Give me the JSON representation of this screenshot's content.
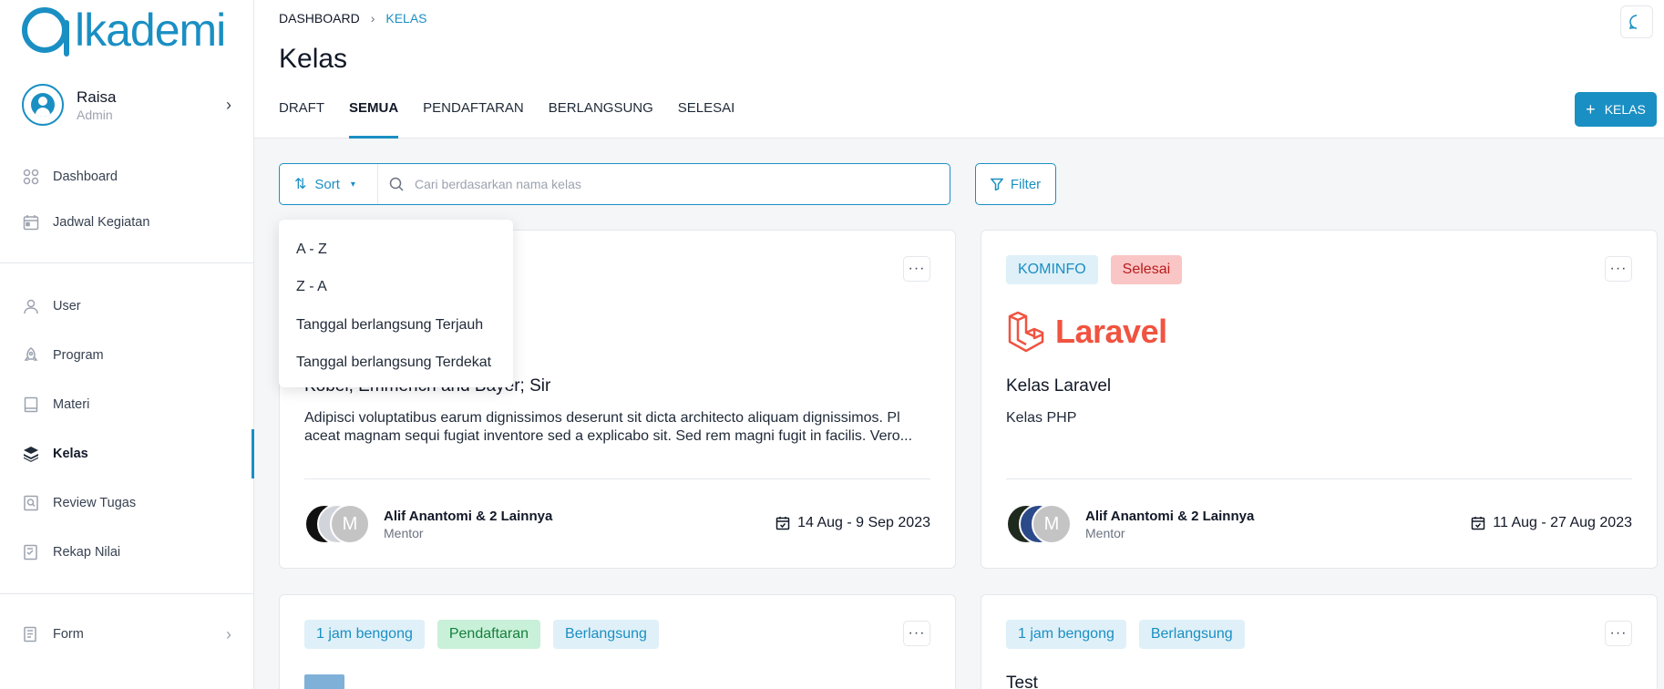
{
  "brand": {
    "logo_text": "lkademi",
    "color": "#1a8fc3"
  },
  "profile": {
    "name": "Raisa",
    "role": "Admin"
  },
  "sidebar": {
    "items": [
      {
        "label": "Dashboard",
        "icon": "grid-icon"
      },
      {
        "label": "Jadwal Kegiatan",
        "icon": "calendar-icon"
      },
      {
        "label": "User",
        "icon": "user-icon"
      },
      {
        "label": "Program",
        "icon": "rocket-icon"
      },
      {
        "label": "Materi",
        "icon": "book-icon"
      },
      {
        "label": "Kelas",
        "icon": "layers-icon",
        "active": true
      },
      {
        "label": "Review Tugas",
        "icon": "review-icon"
      },
      {
        "label": "Rekap Nilai",
        "icon": "checklist-icon"
      },
      {
        "label": "Form",
        "icon": "form-icon"
      }
    ]
  },
  "breadcrumb": {
    "root": "DASHBOARD",
    "current": "KELAS"
  },
  "page": {
    "title": "Kelas"
  },
  "tabs": [
    "DRAFT",
    "SEMUA",
    "PENDAFTARAN",
    "BERLANGSUNG",
    "SELESAI"
  ],
  "active_tab": "SEMUA",
  "toolbar": {
    "add_label": "KELAS",
    "sort_label": "Sort",
    "filter_label": "Filter"
  },
  "search": {
    "placeholder": "Cari berdasarkan nama kelas",
    "value": ""
  },
  "sort_menu": {
    "options": [
      "A - Z",
      "Z - A",
      "Tanggal berlangsung Terjauh",
      "Tanggal berlangsung Terdekat"
    ]
  },
  "cards": [
    {
      "title": "Kobel, Emmerich and Bayer; Sir",
      "description": "Adipisci voluptatibus earum dignissimos deserunt sit dicta architecto aliquam dignissimos. Pl aceat magnam sequi fugiat inventore sed a explicabo sit. Sed rem magni fugit in facilis. Vero...",
      "mentor_name": "Alif Anantomi & 2 Lainnya",
      "mentor_role": "Mentor",
      "avatar_letter": "M",
      "date": "14 Aug - 9 Sep 2023"
    },
    {
      "badges": [
        "KOMINFO",
        "Selesai"
      ],
      "logo_text": "Laravel",
      "title": "Kelas Laravel",
      "subtitle": "Kelas PHP",
      "mentor_name": "Alif Anantomi & 2 Lainnya",
      "mentor_role": "Mentor",
      "avatar_letter": "M",
      "date": "11 Aug - 27 Aug 2023"
    },
    {
      "badges": [
        "1 jam bengong",
        "Pendaftaran",
        "Berlangsung"
      ]
    },
    {
      "badges": [
        "1 jam bengong",
        "Berlangsung"
      ],
      "title": "Test"
    }
  ]
}
